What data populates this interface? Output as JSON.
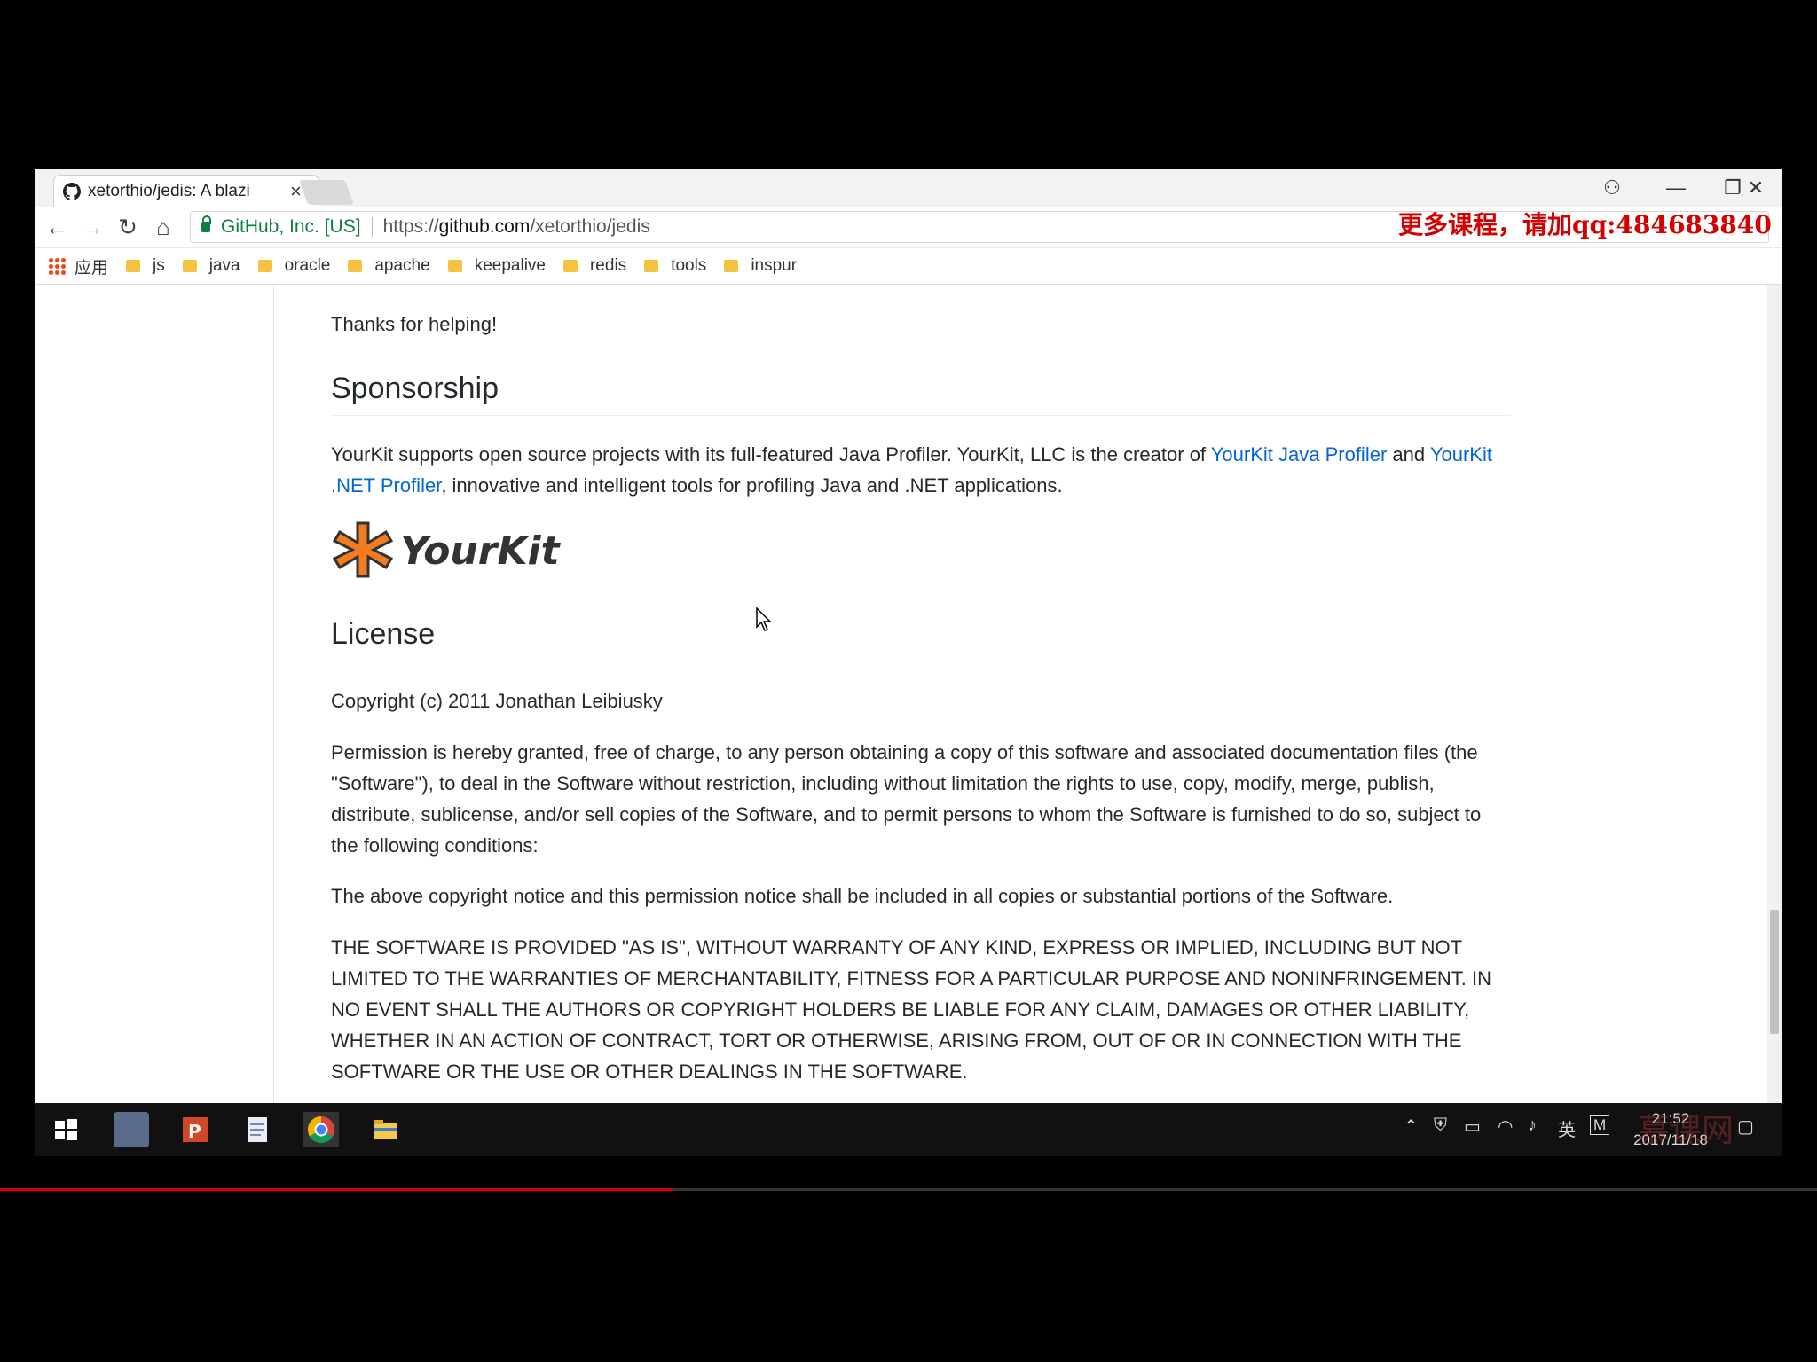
{
  "tab": {
    "title": "xetorthio/jedis: A blazi",
    "close": "×"
  },
  "window_controls": {
    "account": "⚇",
    "minimize": "—",
    "restore": "❐",
    "close": "✕"
  },
  "omnibox": {
    "ev_label": "GitHub, Inc. [US]",
    "url_scheme": "https://",
    "url_host": "github.com",
    "url_path": "/xetorthio/jedis"
  },
  "bookmarks": {
    "apps_label": "应用",
    "items": [
      "js",
      "java",
      "oracle",
      "apache",
      "keepalive",
      "redis",
      "tools",
      "inspur"
    ]
  },
  "content": {
    "thanks": "Thanks for helping!",
    "sponsorship_heading": "Sponsorship",
    "sponsor_text_1": "YourKit supports open source projects with its full-featured Java Profiler. YourKit, LLC is the creator of ",
    "sponsor_link_1": "YourKit Java Profiler",
    "sponsor_text_2": " and ",
    "sponsor_link_2": "YourKit .NET Profiler",
    "sponsor_text_3": ", innovative and intelligent tools for profiling Java and .NET applications.",
    "logo_text": "YourKit",
    "license_heading": "License",
    "copyright": "Copyright (c) 2011 Jonathan Leibiusky",
    "permission": "Permission is hereby granted, free of charge, to any person obtaining a copy of this software and associated documentation files (the \"Software\"), to deal in the Software without restriction, including without limitation the rights to use, copy, modify, merge, publish, distribute, sublicense, and/or sell copies of the Software, and to permit persons to whom the Software is furnished to do so, subject to the following conditions:",
    "notice": "The above copyright notice and this permission notice shall be included in all copies or substantial portions of the Software.",
    "warranty": "THE SOFTWARE IS PROVIDED \"AS IS\", WITHOUT WARRANTY OF ANY KIND, EXPRESS OR IMPLIED, INCLUDING BUT NOT LIMITED TO THE WARRANTIES OF MERCHANTABILITY, FITNESS FOR A PARTICULAR PURPOSE AND NONINFRINGEMENT. IN NO EVENT SHALL THE AUTHORS OR COPYRIGHT HOLDERS BE LIABLE FOR ANY CLAIM, DAMAGES OR OTHER LIABILITY, WHETHER IN AN ACTION OF CONTRACT, TORT OR OTHERWISE, ARISING FROM, OUT OF OR IN CONNECTION WITH THE SOFTWARE OR THE USE OR OTHER DEALINGS IN THE SOFTWARE."
  },
  "watermark": "更多课程，请加qq:484683840",
  "taskbar": {
    "ime": "英",
    "mail": "M",
    "time": "21:52",
    "date": "2017/11/18",
    "watermark_logo": "慕课网"
  },
  "colors": {
    "link": "#0366d6",
    "ev_green": "#0b8043",
    "watermark_red": "#d40000"
  },
  "video_progress": 0.37
}
